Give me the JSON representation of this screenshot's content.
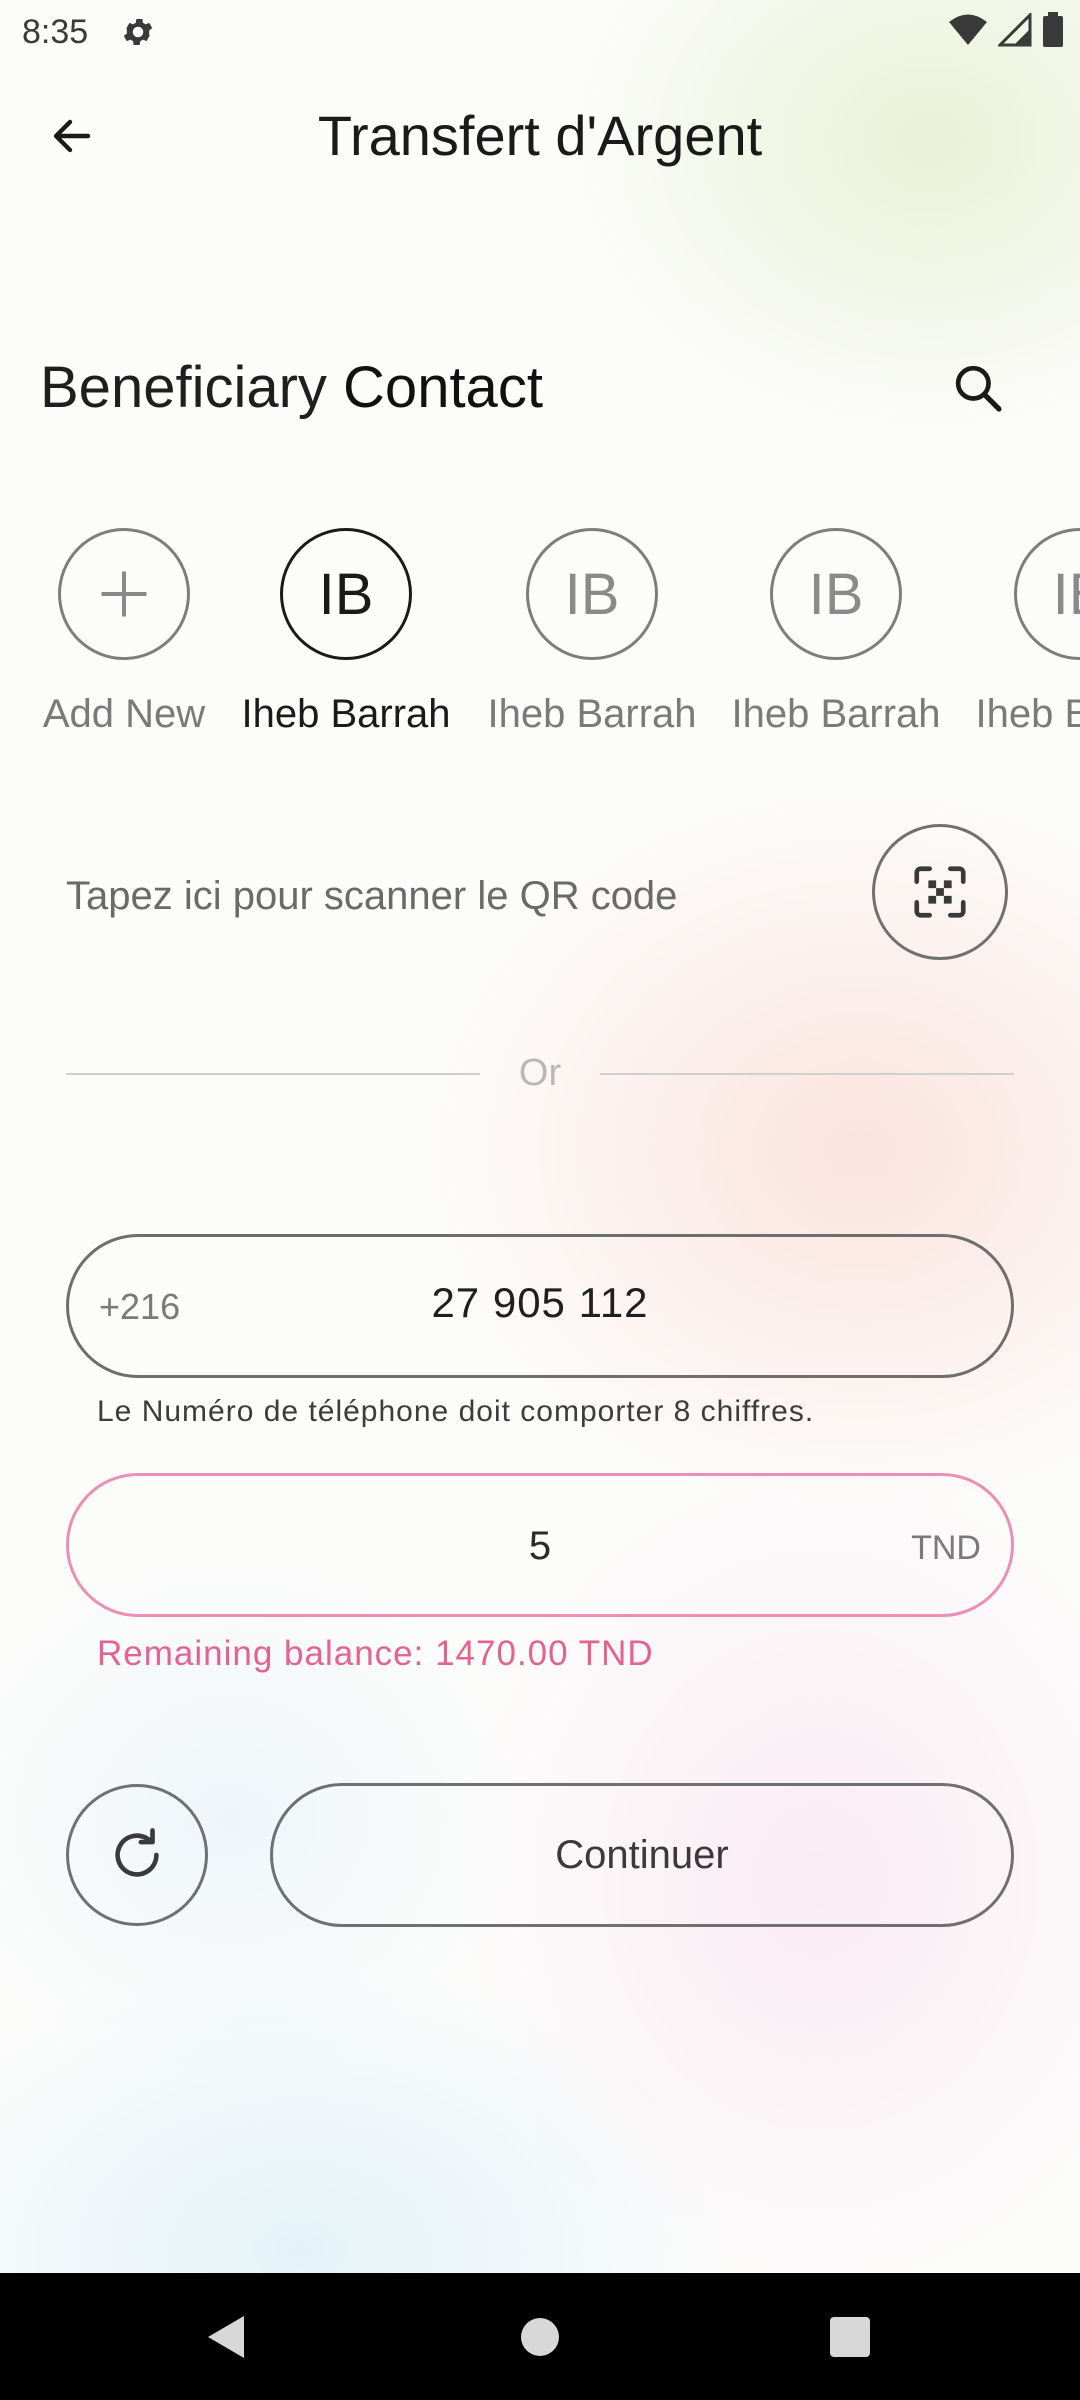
{
  "status_bar": {
    "time": "8:35",
    "icons": [
      "gear-icon",
      "wifi-icon",
      "cell-signal-icon",
      "battery-icon"
    ]
  },
  "header": {
    "title": "Transfert d'Argent",
    "back_icon": "arrow-left-icon"
  },
  "beneficiary": {
    "title_light": "Beneficiary",
    "title_bold": "Contact",
    "search_icon": "search-icon",
    "contacts": [
      {
        "initials": "+",
        "name": "Add New",
        "icon": "plus-icon"
      },
      {
        "initials": "IB",
        "name": "Iheb Barrah",
        "selected": true
      },
      {
        "initials": "IB",
        "name": "Iheb Barrah"
      },
      {
        "initials": "IB",
        "name": "Iheb Barrah"
      },
      {
        "initials": "IB",
        "name": "Iheb Barrah"
      }
    ]
  },
  "qr": {
    "label": "Tapez ici pour scanner le QR code",
    "icon": "qr-scan-icon"
  },
  "divider": {
    "label": "Or"
  },
  "phone": {
    "prefix": "+216",
    "value": "27 905 112",
    "helper": "Le Numéro de téléphone doit comporter 8 chiffres."
  },
  "amount": {
    "value": "5",
    "suffix": "TND",
    "balance": "Remaining balance: 1470.00 TND"
  },
  "actions": {
    "refresh_icon": "refresh-icon",
    "continue_label": "Continuer"
  },
  "colors": {
    "accent_pink": "#e3628f",
    "amount_border": "#ec8fb4",
    "nav_bar": "#000000"
  },
  "nav_bar": {
    "buttons": [
      "back-triangle-icon",
      "home-circle-icon",
      "recents-square-icon"
    ]
  }
}
